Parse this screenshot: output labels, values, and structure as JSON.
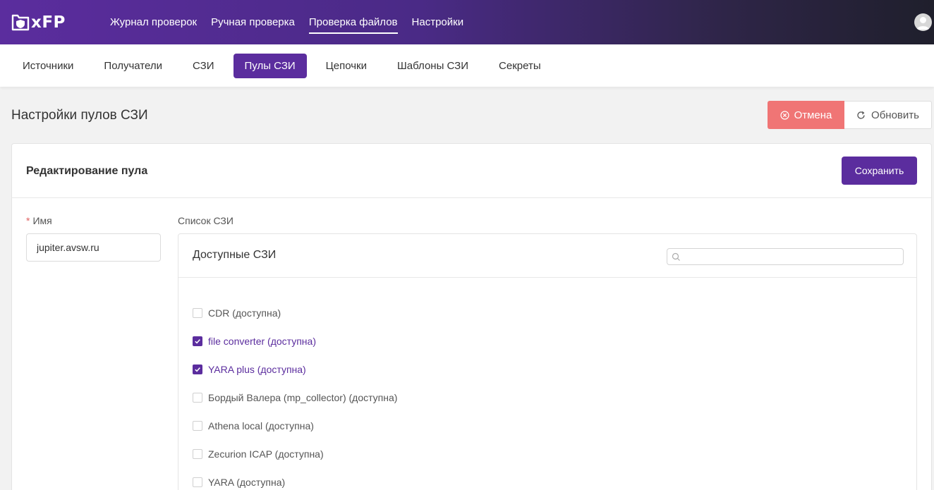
{
  "app": {
    "logo_text": "xFP"
  },
  "topnav": {
    "items": [
      {
        "label": "Журнал проверок",
        "active": false
      },
      {
        "label": "Ручная проверка",
        "active": false
      },
      {
        "label": "Проверка файлов",
        "active": true
      },
      {
        "label": "Настройки",
        "active": false
      }
    ]
  },
  "subnav": {
    "items": [
      {
        "label": "Источники",
        "active": false
      },
      {
        "label": "Получатели",
        "active": false
      },
      {
        "label": "СЗИ",
        "active": false
      },
      {
        "label": "Пулы СЗИ",
        "active": true
      },
      {
        "label": "Цепочки",
        "active": false
      },
      {
        "label": "Шаблоны СЗИ",
        "active": false
      },
      {
        "label": "Секреты",
        "active": false
      }
    ]
  },
  "page": {
    "title": "Настройки пулов СЗИ",
    "cancel_label": "Отмена",
    "refresh_label": "Обновить"
  },
  "card": {
    "title": "Редактирование пула",
    "save_label": "Сохранить",
    "name_label": "Имя",
    "name_value": "jupiter.avsw.ru",
    "list_label": "Список СЗИ",
    "list_title": "Доступные СЗИ",
    "search_value": "",
    "items": [
      {
        "label": "CDR (доступна)",
        "checked": false
      },
      {
        "label": "file converter (доступна)",
        "checked": true
      },
      {
        "label": "YARA plus (доступна)",
        "checked": true
      },
      {
        "label": "Бордый Валера (mp_collector) (доступна)",
        "checked": false
      },
      {
        "label": "Athena local (доступна)",
        "checked": false
      },
      {
        "label": "Zecurion ICAP (доступна)",
        "checked": false
      },
      {
        "label": "YARA (доступна)",
        "checked": false
      }
    ]
  },
  "colors": {
    "accent": "#5b2d9e",
    "cancel": "#f07575"
  }
}
